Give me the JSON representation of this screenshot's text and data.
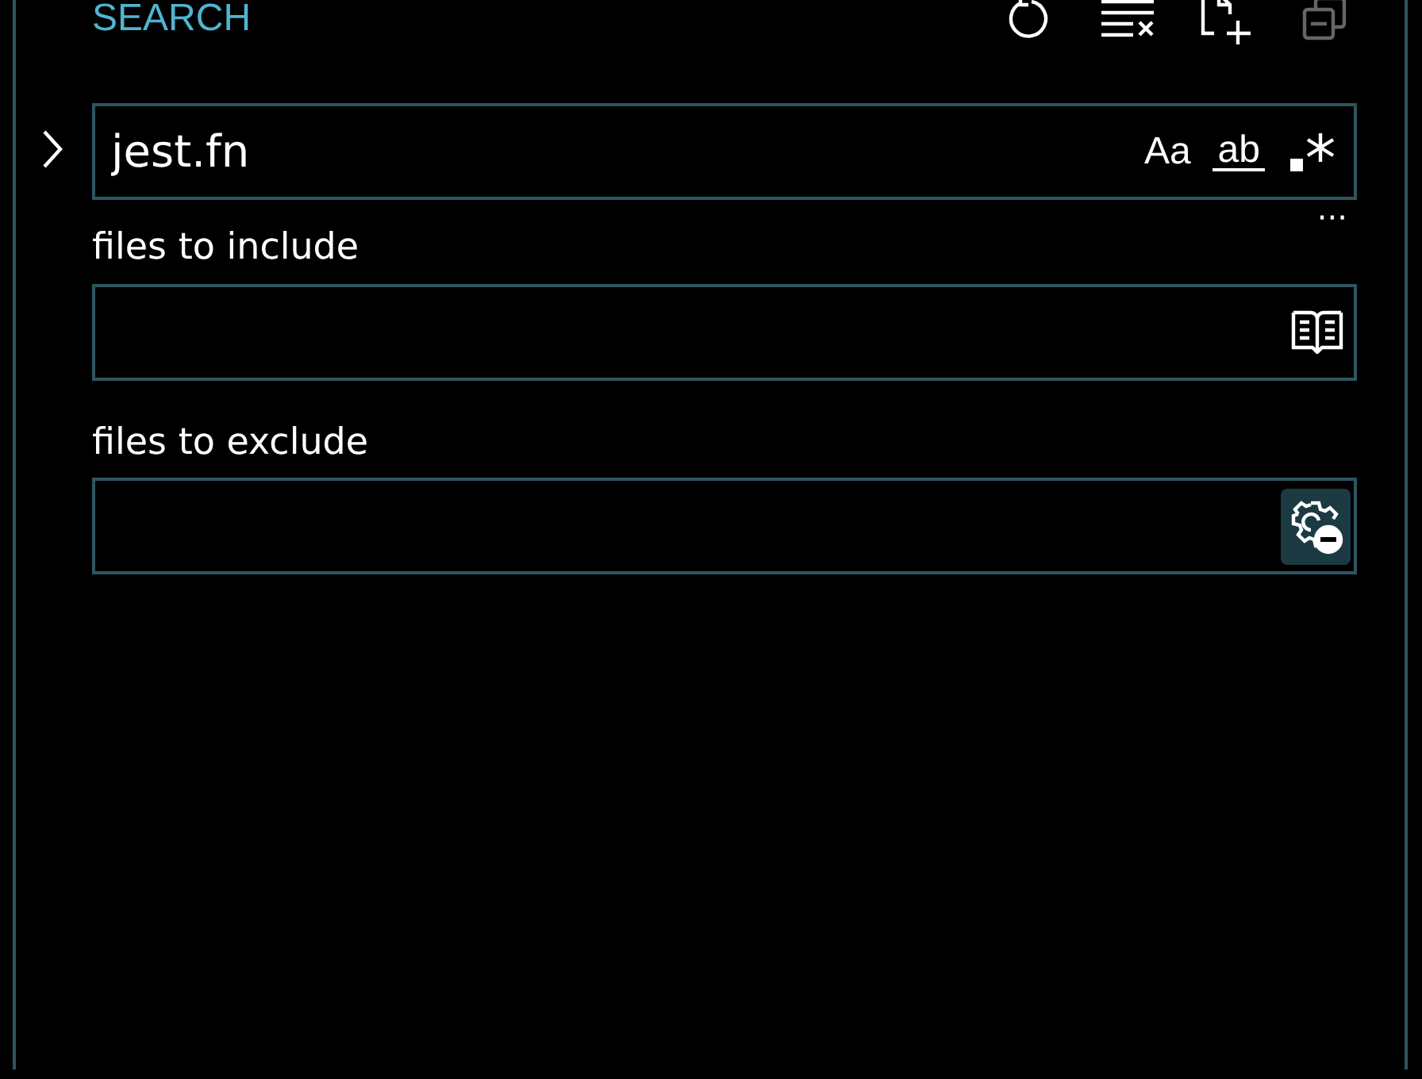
{
  "header": {
    "title": "SEARCH",
    "actions": [
      {
        "kind": "refresh",
        "disabled": false
      },
      {
        "kind": "clear",
        "disabled": false
      },
      {
        "kind": "new-editor",
        "disabled": false
      },
      {
        "kind": "collapse",
        "disabled": true
      }
    ]
  },
  "replace_toggle": {
    "expanded": false
  },
  "search": {
    "value": "jest.fn",
    "options": [
      {
        "kind": "case",
        "label": "Aa",
        "selected": false
      },
      {
        "kind": "word",
        "label": "ab",
        "selected": false
      },
      {
        "kind": "regex",
        "selected": false
      }
    ]
  },
  "details_toggle": {
    "label": "···"
  },
  "include": {
    "label": "files to include",
    "button": {
      "kind": "book",
      "selected": false
    }
  },
  "exclude": {
    "label": "files to exclude",
    "button": {
      "kind": "gear",
      "selected": true
    }
  }
}
